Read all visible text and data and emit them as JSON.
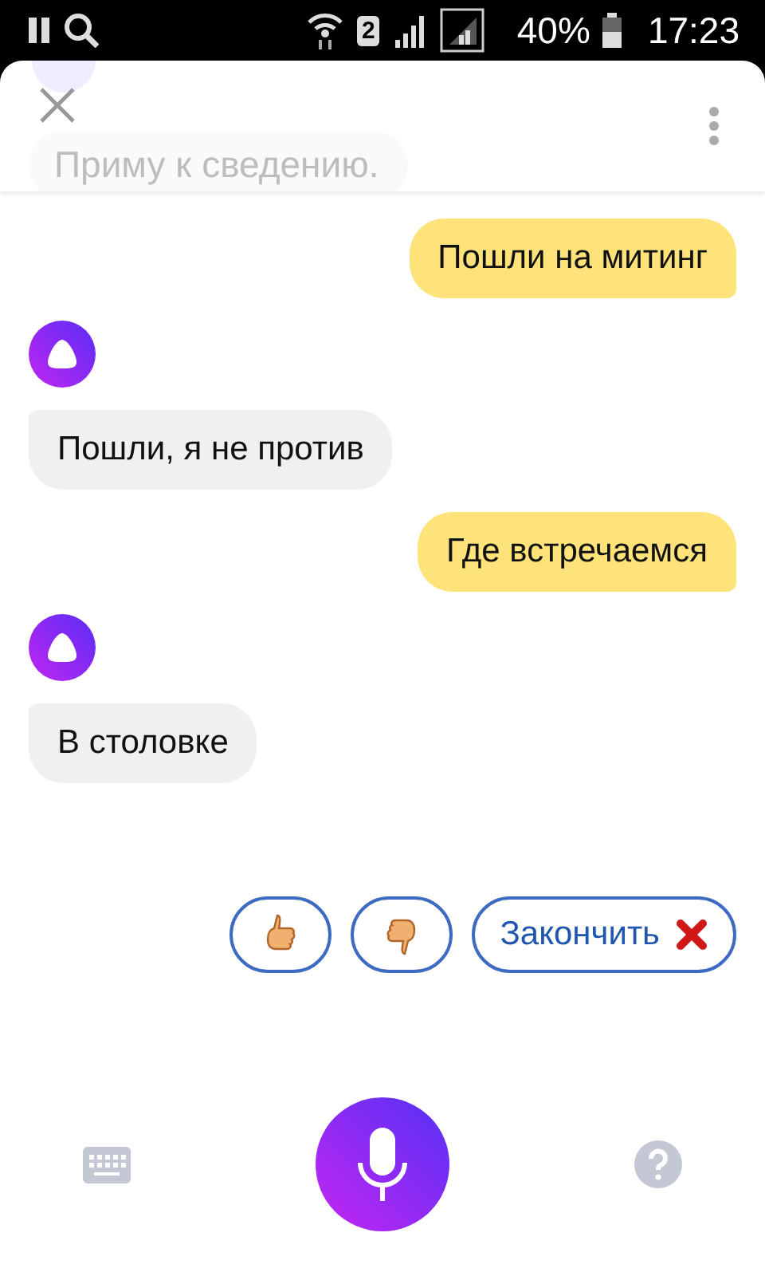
{
  "status_bar": {
    "sim": "2",
    "battery": "40%",
    "time": "17:23"
  },
  "faded_message": {
    "text": "Приму к сведению."
  },
  "messages": [
    {
      "kind": "user",
      "text": "Пошли на митинг"
    },
    {
      "kind": "assistant",
      "text": "Пошли, я не против"
    },
    {
      "kind": "user",
      "text": "Где встречаемся"
    },
    {
      "kind": "assistant",
      "text": "В столовке"
    }
  ],
  "quick_replies": [
    {
      "kind": "like"
    },
    {
      "kind": "dislike"
    },
    {
      "kind": "end",
      "label": "Закончить"
    }
  ]
}
